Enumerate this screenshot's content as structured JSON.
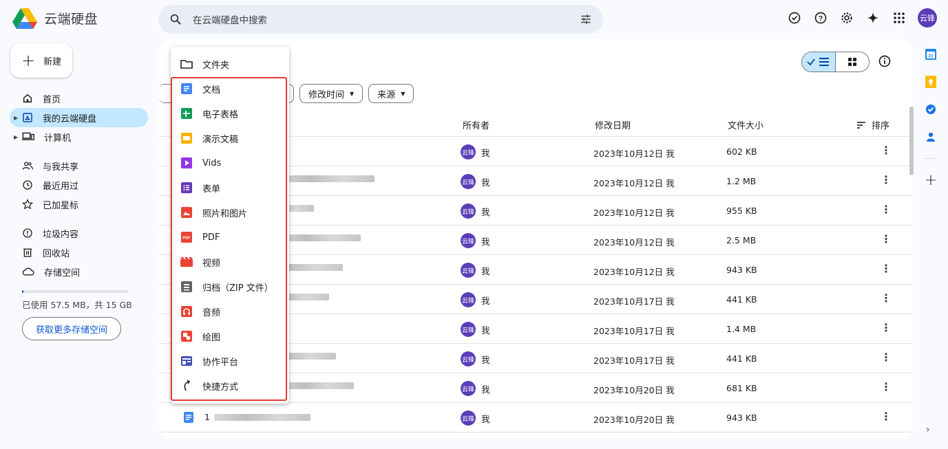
{
  "app": {
    "title": "云端硬盘"
  },
  "search": {
    "placeholder": "在云端硬盘中搜索"
  },
  "header": {
    "avatar_text": "云锋"
  },
  "sidebar": {
    "new_label": "新建",
    "items": [
      {
        "label": "首页"
      },
      {
        "label": "我的云端硬盘"
      },
      {
        "label": "计算机"
      },
      {
        "label": "与我共享"
      },
      {
        "label": "最近用过"
      },
      {
        "label": "已加星标"
      },
      {
        "label": "垃圾内容"
      },
      {
        "label": "回收站"
      },
      {
        "label": "存储空间"
      }
    ],
    "storage_text": "已使用 57.5 MB，共 15 GB",
    "storage_fraction": 0.004,
    "get_more_label": "获取更多存储空间"
  },
  "filters": {
    "modified": "修改时间",
    "source": "来源"
  },
  "table": {
    "headers": {
      "owner": "所有者",
      "modified": "修改日期",
      "size": "文件大小",
      "sort": "排序"
    },
    "rows": [
      {
        "name_prefix": "",
        "owner": "我",
        "date": "2023年10月12日 我",
        "size": "602 KB"
      },
      {
        "name_prefix": "",
        "owner": "我",
        "date": "2023年10月12日 我",
        "size": "1.2 MB"
      },
      {
        "name_prefix": "",
        "owner": "我",
        "date": "2023年10月12日 我",
        "size": "955 KB"
      },
      {
        "name_prefix": "",
        "owner": "我",
        "date": "2023年10月12日 我",
        "size": "2.5 MB"
      },
      {
        "name_prefix": "",
        "owner": "我",
        "date": "2023年10月12日 我",
        "size": "943 KB"
      },
      {
        "name_prefix": "",
        "owner": "我",
        "date": "2023年10月17日 我",
        "size": "441 KB"
      },
      {
        "name_prefix": "",
        "owner": "我",
        "date": "2023年10月17日 我",
        "size": "1.4 MB"
      },
      {
        "name_prefix": "",
        "owner": "我",
        "date": "2023年10月17日 我",
        "size": "441 KB"
      },
      {
        "name_prefix": "",
        "owner": "我",
        "date": "2023年10月20日 我",
        "size": "681 KB"
      },
      {
        "name_prefix": "1",
        "owner": "我",
        "date": "2023年10月20日 我",
        "size": "943 KB"
      }
    ],
    "owner_avatar_text": "云锋"
  },
  "menu": {
    "items": [
      {
        "label": "文件夹",
        "icon": "folder-icon"
      },
      {
        "label": "文档",
        "icon": "docs-icon"
      },
      {
        "label": "电子表格",
        "icon": "sheets-icon"
      },
      {
        "label": "演示文稿",
        "icon": "slides-icon"
      },
      {
        "label": "Vids",
        "icon": "vids-icon"
      },
      {
        "label": "表单",
        "icon": "forms-icon"
      },
      {
        "label": "照片和图片",
        "icon": "image-icon"
      },
      {
        "label": "PDF",
        "icon": "pdf-icon"
      },
      {
        "label": "视频",
        "icon": "video-icon"
      },
      {
        "label": "归档（ZIP 文件）",
        "icon": "archive-icon"
      },
      {
        "label": "音频",
        "icon": "audio-icon"
      },
      {
        "label": "绘图",
        "icon": "drawings-icon"
      },
      {
        "label": "协作平台",
        "icon": "sites-icon"
      },
      {
        "label": "快捷方式",
        "icon": "shortcut-icon"
      }
    ]
  },
  "colors": {
    "accent": "#0b57d0",
    "active_nav": "#c2e7ff",
    "highlight": "#e53935",
    "avatar": "#5b3eb8"
  }
}
